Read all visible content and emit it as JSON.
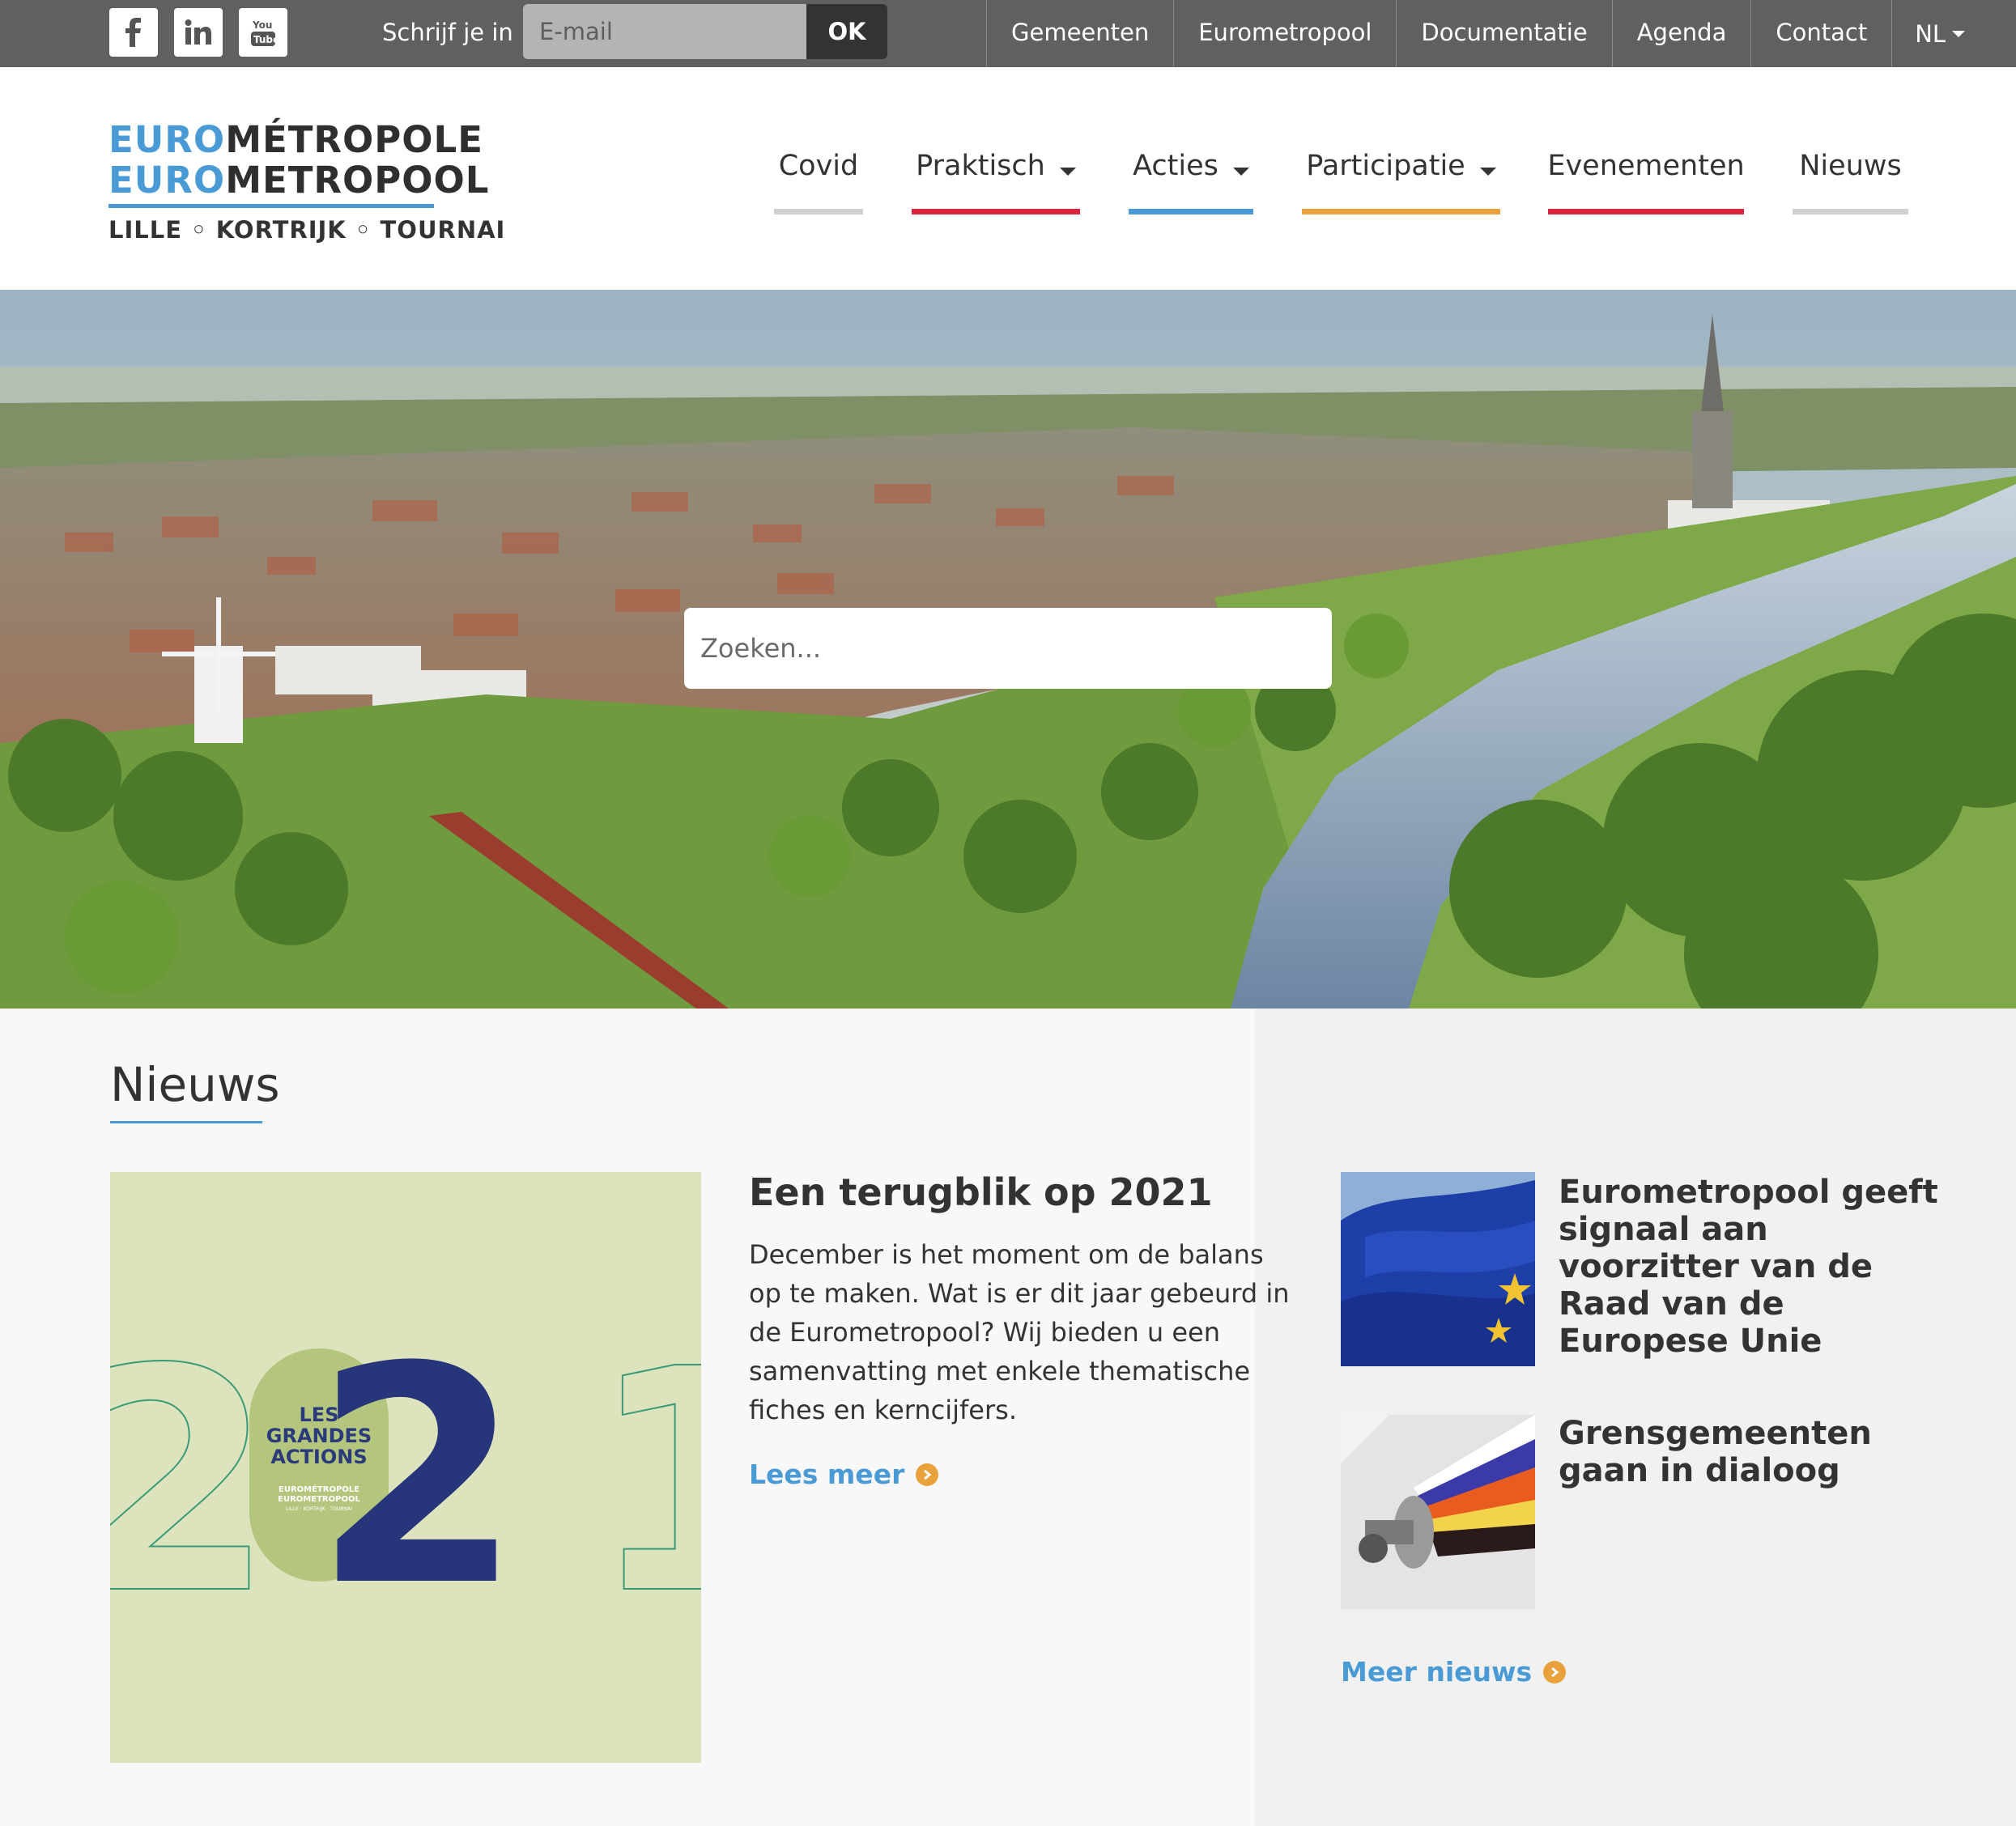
{
  "topbar": {
    "social": [
      {
        "name": "facebook",
        "icon": "facebook-icon",
        "glyph": "f"
      },
      {
        "name": "linkedin",
        "icon": "linkedin-icon",
        "glyph": "in"
      },
      {
        "name": "youtube",
        "icon": "youtube-icon",
        "glyph": "You Tube"
      }
    ],
    "subscribe_label": "Schrijf je in",
    "email_placeholder": "E-mail",
    "ok_label": "OK",
    "nav": [
      "Gemeenten",
      "Eurometropool",
      "Documentatie",
      "Agenda",
      "Contact"
    ],
    "language": "NL"
  },
  "logo": {
    "line1_blue": "EURO",
    "line1_dark": "MÉTROPOLE",
    "line2_blue": "EURO",
    "line2_dark": "METROPOOL",
    "subline": "LILLE ◦ KORTRIJK ◦ TOURNAI"
  },
  "main_nav": [
    {
      "label": "Covid",
      "has_dropdown": false,
      "accent": "#cfcfcf"
    },
    {
      "label": "Praktisch",
      "has_dropdown": true,
      "accent": "#d7263d"
    },
    {
      "label": "Acties",
      "has_dropdown": true,
      "accent": "#4a9bd5"
    },
    {
      "label": "Participatie",
      "has_dropdown": true,
      "accent": "#e9a23b"
    },
    {
      "label": "Evenementen",
      "has_dropdown": false,
      "accent": "#d7263d"
    },
    {
      "label": "Nieuws",
      "has_dropdown": false,
      "accent": "#cfcfcf"
    }
  ],
  "hero": {
    "search_placeholder": "Zoeken..."
  },
  "news": {
    "section_title": "Nieuws",
    "featured": {
      "title": "Een terugblik op 2021",
      "body": "December is het moment om de balans op te maken. Wat is er dit jaar gebeurd in de Eurometropool? Wij bieden u een samenvatting met enkele thematische fiches en kerncijfers.",
      "read_more": "Lees meer",
      "image": {
        "year_left": "2",
        "year_mid": "0",
        "year_big": "2",
        "year_right": "1",
        "badge_line1": "LES",
        "badge_line2": "GRANDES",
        "badge_line3": "ACTIONS",
        "badge_small1": "EUROMÉTROPOLE",
        "badge_small2": "EUROMETROPOOL",
        "badge_small3": "LILLE · KORTRIJK · TOURNAI"
      }
    },
    "side_items": [
      {
        "title": "Eurometropool geeft signaal aan voorzitter van de Raad van de Europese Unie",
        "image": "eu-flag"
      },
      {
        "title": "Grensgemeenten gaan in dialoog",
        "image": "megaphone"
      }
    ],
    "more_news": "Meer nieuws"
  },
  "colors": {
    "topbar": "#606060",
    "brand_blue": "#4a9bd5",
    "brand_red": "#d7263d",
    "brand_orange": "#e9a23b",
    "text_dark": "#333333"
  }
}
